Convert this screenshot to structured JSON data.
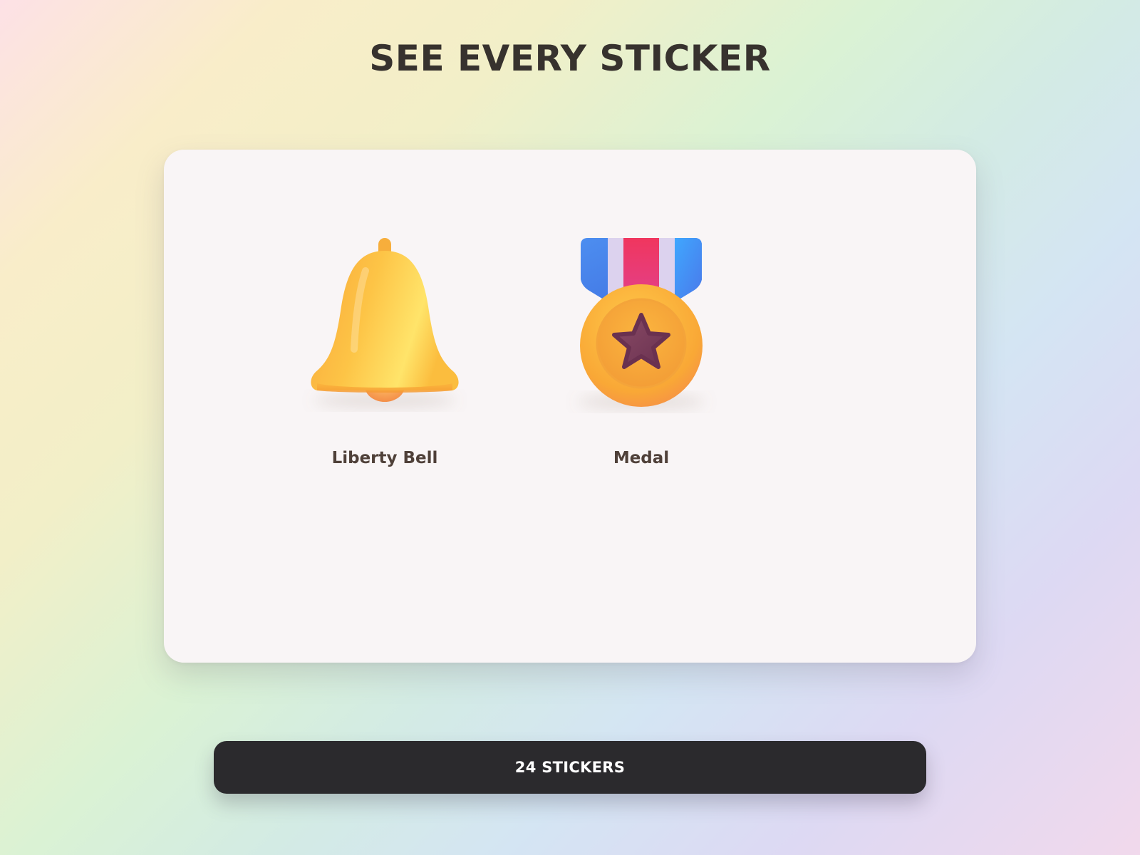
{
  "page": {
    "title": "SEE EVERY STICKER"
  },
  "stickers": [
    {
      "label": "Liberty Bell",
      "icon": "bell-icon"
    },
    {
      "label": "Medal",
      "icon": "medal-icon"
    }
  ],
  "footer": {
    "count_label": "24 STICKERS"
  }
}
